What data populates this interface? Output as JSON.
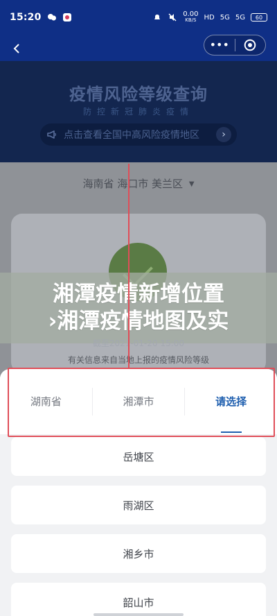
{
  "status": {
    "time": "15:20",
    "network_speed": "0.00",
    "network_unit": "KB/S",
    "hd_label": "HD",
    "signal_1": "5G",
    "signal_2": "5G",
    "battery": "60"
  },
  "hero": {
    "title": "疫情风险等级查询",
    "subtitle": "防控新冠肺炎疫情",
    "notice": "点击查看全国中高风险疫情地区"
  },
  "location": {
    "text": "海南省 海口市 美兰区"
  },
  "watermark": {
    "line1": "湘潭疫情新增位置",
    "line2": "›湘潭疫情地图及实"
  },
  "card": {
    "date_text": "截至2021-01-20 15:00",
    "info_text": "有关信息来自当地上报的疫情风险等级"
  },
  "picker": {
    "tabs": [
      {
        "label": "湖南省"
      },
      {
        "label": "湘潭市"
      },
      {
        "label": "请选择"
      }
    ],
    "options": [
      "岳塘区",
      "雨湖区",
      "湘乡市",
      "韶山市"
    ]
  },
  "colors": {
    "primary_blue": "#0f2f86",
    "accent_blue": "#1f5faf",
    "annotation_red": "#e04d58",
    "success_green": "#5a7b45"
  }
}
